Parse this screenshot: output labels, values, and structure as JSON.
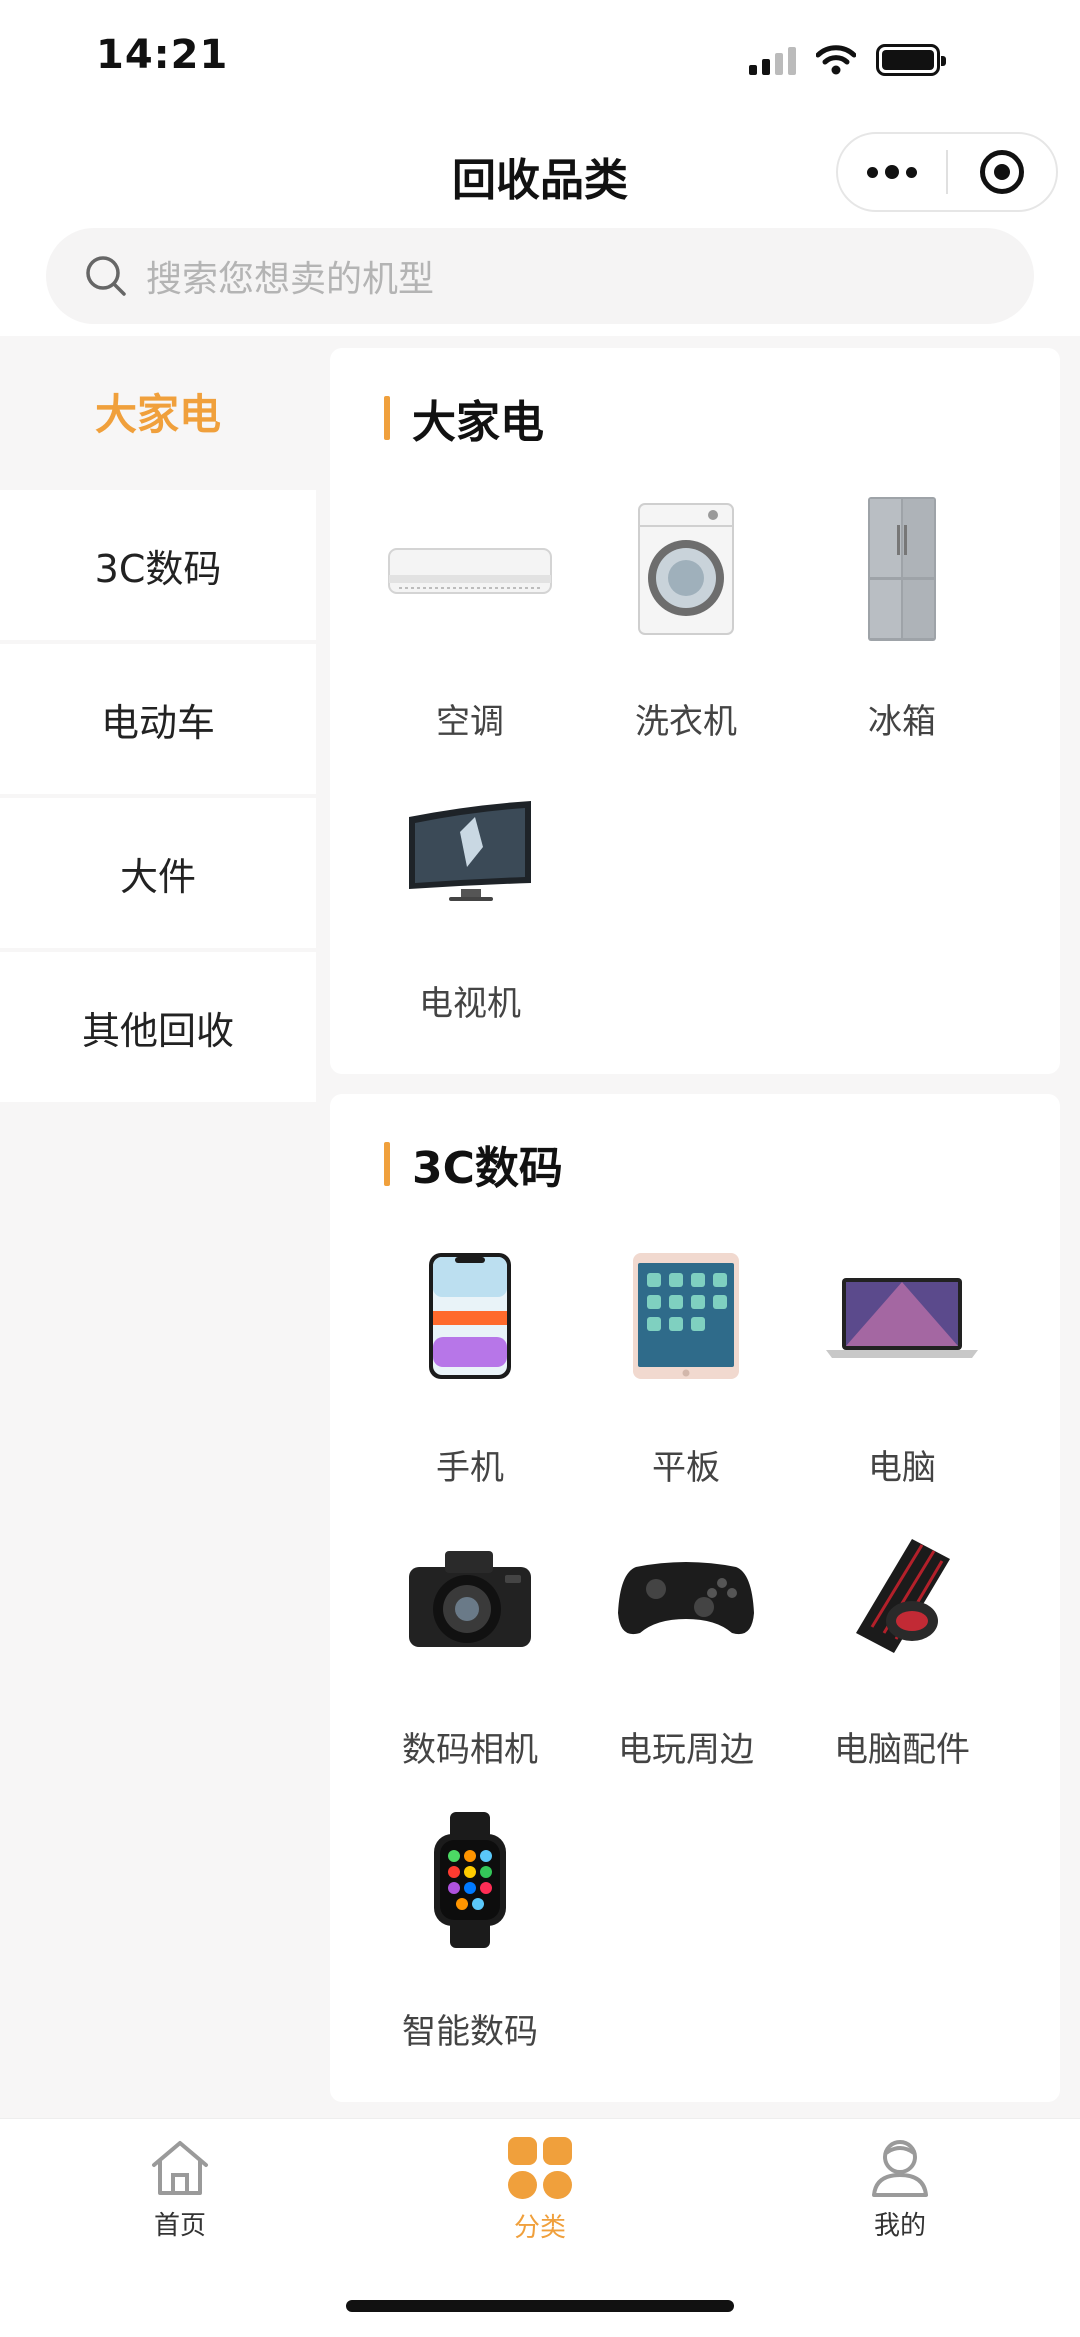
{
  "status_bar": {
    "time": "14:21"
  },
  "nav": {
    "title": "回收品类"
  },
  "search": {
    "placeholder": "搜索您想卖的机型"
  },
  "sidebar": {
    "items": [
      {
        "label": "大家电",
        "active": true
      },
      {
        "label": "3C数码",
        "active": false
      },
      {
        "label": "电动车",
        "active": false
      },
      {
        "label": "大件",
        "active": false
      },
      {
        "label": "其他回收",
        "active": false
      }
    ]
  },
  "sections": [
    {
      "title": "大家电",
      "items": [
        {
          "label": "空调",
          "icon": "air-conditioner-icon"
        },
        {
          "label": "洗衣机",
          "icon": "washing-machine-icon"
        },
        {
          "label": "冰箱",
          "icon": "fridge-icon"
        },
        {
          "label": "电视机",
          "icon": "tv-icon"
        }
      ]
    },
    {
      "title": "3C数码",
      "items": [
        {
          "label": "手机",
          "icon": "phone-icon"
        },
        {
          "label": "平板",
          "icon": "tablet-icon"
        },
        {
          "label": "电脑",
          "icon": "laptop-icon"
        },
        {
          "label": "数码相机",
          "icon": "camera-icon"
        },
        {
          "label": "电玩周边",
          "icon": "gamepad-icon"
        },
        {
          "label": "电脑配件",
          "icon": "keyboard-mouse-icon"
        },
        {
          "label": "智能数码",
          "icon": "smartwatch-icon"
        }
      ]
    }
  ],
  "tabbar": {
    "tabs": [
      {
        "label": "首页",
        "icon": "home-icon",
        "active": false
      },
      {
        "label": "分类",
        "icon": "category-icon",
        "active": true
      },
      {
        "label": "我的",
        "icon": "profile-icon",
        "active": false
      }
    ]
  },
  "colors": {
    "accent": "#f0a03c",
    "background": "#f7f6f6"
  }
}
